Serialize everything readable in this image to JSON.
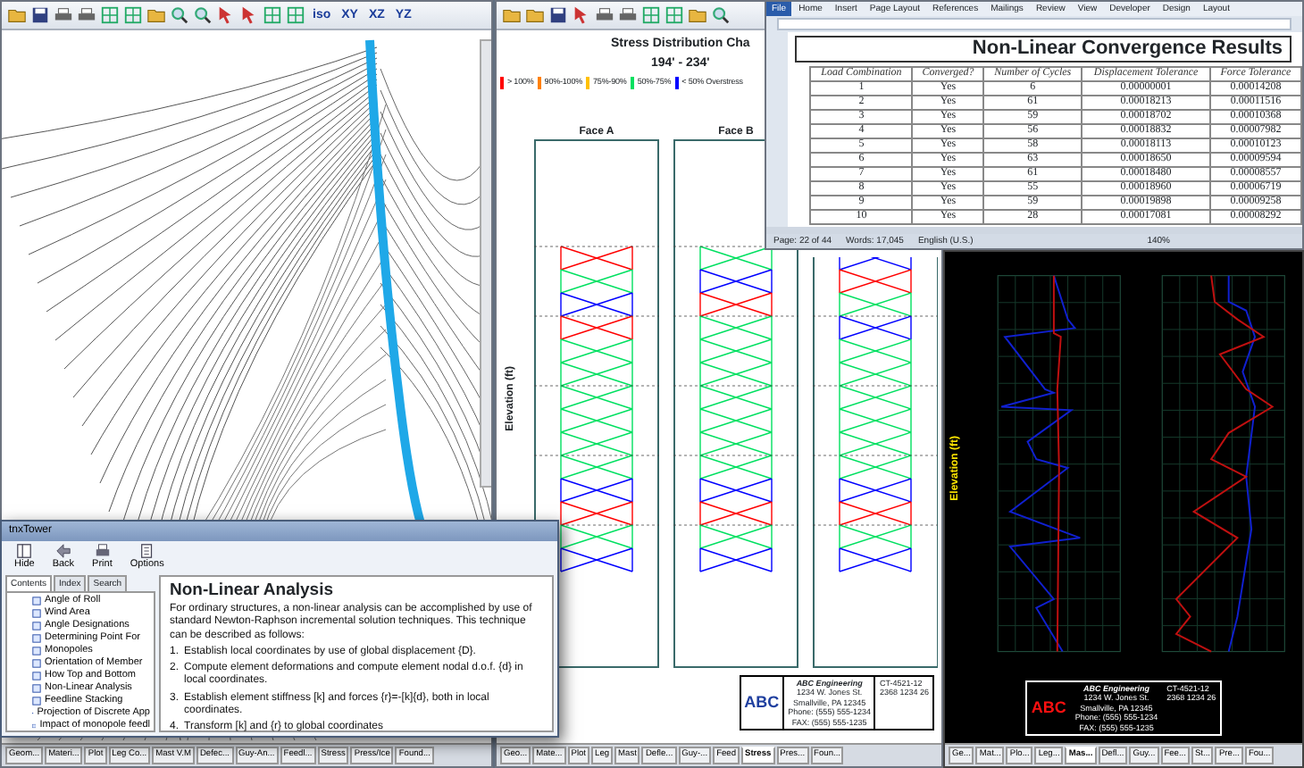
{
  "tower_window": {
    "view_buttons": [
      "iso",
      "XY",
      "XZ",
      "YZ"
    ],
    "tabs": [
      {
        "label": "Geom...",
        "selected": false
      },
      {
        "label": "Materi...",
        "selected": false
      },
      {
        "label": "Plot",
        "selected": false
      },
      {
        "label": "Leg Co...",
        "selected": false
      },
      {
        "label": "Mast V.M",
        "selected": false
      },
      {
        "label": "Defec...",
        "selected": false
      },
      {
        "label": "Guy-An...",
        "selected": false
      },
      {
        "label": "Feedl...",
        "selected": false
      },
      {
        "label": "Stress",
        "selected": false
      },
      {
        "label": "Press/Ice",
        "selected": false
      },
      {
        "label": "Found...",
        "selected": false
      }
    ]
  },
  "stress_window": {
    "chart_title": "Stress Distribution Cha",
    "range": "194' - 234'",
    "legend": [
      {
        "label": "> 100%",
        "color": "#ff0000"
      },
      {
        "label": "90%-100%",
        "color": "#ff8000"
      },
      {
        "label": "75%-90%",
        "color": "#ffc000"
      },
      {
        "label": "50%-75%",
        "color": "#00e060"
      },
      {
        "label": "< 50% Overstress",
        "color": "#0000ff"
      }
    ],
    "faces": [
      {
        "label": "Face A"
      },
      {
        "label": "Face B"
      }
    ],
    "axis_label": "Elevation (ft)",
    "title_block": {
      "logo": "ABC",
      "company": "ABC Engineering",
      "address": [
        "1234 W. Jones St.",
        "Smallville, PA 12345",
        "Phone: (555) 555-1234",
        "FAX: (555) 555-1235"
      ],
      "job": "CT-4521-12",
      "project": "2368 1234 26"
    },
    "tabs": [
      {
        "label": "Geo...",
        "selected": false
      },
      {
        "label": "Mate...",
        "selected": false
      },
      {
        "label": "Plot",
        "selected": false
      },
      {
        "label": "Leg",
        "selected": false
      },
      {
        "label": "Mast",
        "selected": false
      },
      {
        "label": "Defle...",
        "selected": false
      },
      {
        "label": "Guy-...",
        "selected": false
      },
      {
        "label": "Feed",
        "selected": false
      },
      {
        "label": "Stress",
        "selected": true
      },
      {
        "label": "Pres...",
        "selected": false
      },
      {
        "label": "Foun...",
        "selected": false
      }
    ]
  },
  "word_window": {
    "ribbon_tabs": [
      {
        "label": "File",
        "kind": "backstage"
      },
      {
        "label": "Home",
        "kind": "tab"
      },
      {
        "label": "Insert",
        "kind": "tab"
      },
      {
        "label": "Page Layout",
        "kind": "tab"
      },
      {
        "label": "References",
        "kind": "tab"
      },
      {
        "label": "Mailings",
        "kind": "tab"
      },
      {
        "label": "Review",
        "kind": "tab"
      },
      {
        "label": "View",
        "kind": "tab"
      },
      {
        "label": "Developer",
        "kind": "tab"
      },
      {
        "label": "Design",
        "kind": "tab"
      },
      {
        "label": "Layout",
        "kind": "tab"
      }
    ],
    "heading": "Non-Linear Convergence Results",
    "columns": [
      "Load Combination",
      "Converged?",
      "Number of Cycles",
      "Displacement Tolerance",
      "Force Tolerance"
    ],
    "rows": [
      [
        "1",
        "Yes",
        "6",
        "0.00000001",
        "0.00014208"
      ],
      [
        "2",
        "Yes",
        "61",
        "0.00018213",
        "0.00011516"
      ],
      [
        "3",
        "Yes",
        "59",
        "0.00018702",
        "0.00010368"
      ],
      [
        "4",
        "Yes",
        "56",
        "0.00018832",
        "0.00007982"
      ],
      [
        "5",
        "Yes",
        "58",
        "0.00018113",
        "0.00010123"
      ],
      [
        "6",
        "Yes",
        "63",
        "0.00018650",
        "0.00009594"
      ],
      [
        "7",
        "Yes",
        "61",
        "0.00018480",
        "0.00008557"
      ],
      [
        "8",
        "Yes",
        "55",
        "0.00018960",
        "0.00006719"
      ],
      [
        "9",
        "Yes",
        "59",
        "0.00019898",
        "0.00009258"
      ],
      [
        "10",
        "Yes",
        "28",
        "0.00017081",
        "0.00008292"
      ]
    ],
    "status": {
      "page": "Page: 22 of 44",
      "words": "Words: 17,045",
      "language": "English (U.S.)",
      "zoom": "140%"
    }
  },
  "plot_window": {
    "axis_label": "Elevation (ft)",
    "title_block": {
      "logo": "ABC",
      "company": "ABC Engineering",
      "address": [
        "1234 W. Jones St.",
        "Smallville, PA 12345",
        "Phone: (555) 555-1234",
        "FAX: (555) 555-1235"
      ],
      "job": "CT-4521-12",
      "project": "2368 1234 26"
    },
    "tabs": [
      {
        "label": "Ge...",
        "selected": false
      },
      {
        "label": "Mat...",
        "selected": false
      },
      {
        "label": "Plo...",
        "selected": false
      },
      {
        "label": "Leg...",
        "selected": false
      },
      {
        "label": "Mas...",
        "selected": true
      },
      {
        "label": "Defl...",
        "selected": false
      },
      {
        "label": "Guy...",
        "selected": false
      },
      {
        "label": "Fee...",
        "selected": false
      },
      {
        "label": "St...",
        "selected": false
      },
      {
        "label": "Pre...",
        "selected": false
      },
      {
        "label": "Fou...",
        "selected": false
      }
    ]
  },
  "help_window": {
    "title": "tnxTower",
    "toolbar": [
      {
        "label": "Hide",
        "kind": "hide"
      },
      {
        "label": "Back",
        "kind": "back"
      },
      {
        "label": "Print",
        "kind": "print"
      },
      {
        "label": "Options",
        "kind": "options"
      }
    ],
    "tabs": [
      {
        "label": "Contents",
        "selected": true
      },
      {
        "label": "Index",
        "selected": false
      },
      {
        "label": "Search",
        "selected": false
      }
    ],
    "topics": [
      "Angle of Roll",
      "Wind Area",
      "Angle Designations",
      "Determining Point For",
      "Monopoles",
      "Orientation of Member",
      "How Top and Bottom",
      "Non-Linear Analysis",
      "Feedline Stacking",
      "Projection of Discrete App",
      "Impact of monopole feedl"
    ],
    "heading": "Non-Linear Analysis",
    "intro": "For ordinary structures, a non-linear analysis can be accomplished by use of standard Newton-Raphson incremental solution techniques. This technique can be described as follows:",
    "steps": [
      {
        "number": "1.",
        "text": "Establish local coordinates by use of global displacement {D}."
      },
      {
        "number": "2.",
        "text": "Compute element deformations and compute element nodal d.o.f. {d} in local coordinates."
      },
      {
        "number": "3.",
        "text": "Establish element stiffness [k] and forces {r}=-[k]{d}, both in local coordinates."
      },
      {
        "number": "4.",
        "text": "Transform [k] and {r} to global coordinates"
      }
    ]
  }
}
